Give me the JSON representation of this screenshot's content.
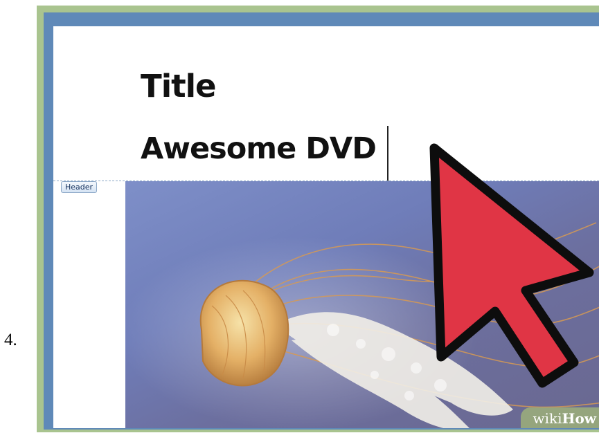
{
  "step": {
    "number": "4."
  },
  "document": {
    "title": "Title",
    "subtitle": "Awesome DVD",
    "header_tag": "Header"
  },
  "watermark": {
    "wiki": "wiki",
    "how": "How"
  },
  "colors": {
    "frame": "#a9c48f",
    "window_border": "#5f89b8",
    "cursor_fill": "#e03545",
    "image_background": "#6f7db9"
  },
  "icons": {
    "pointer": "arrow-cursor-icon",
    "subject": "jellyfish-image"
  }
}
